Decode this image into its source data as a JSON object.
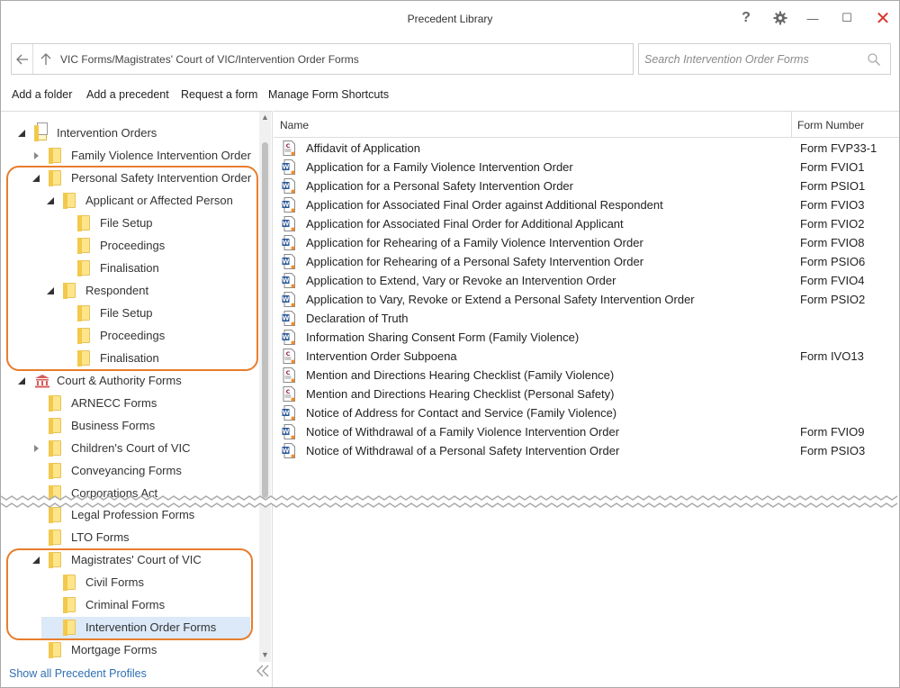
{
  "window": {
    "title": "Precedent Library"
  },
  "controls": {
    "help": "?",
    "minimize": "—",
    "maximize": "☐",
    "close": "✕"
  },
  "address": {
    "path": "VIC Forms/Magistrates' Court of VIC/Intervention Order Forms"
  },
  "search": {
    "placeholder": "Search Intervention Order Forms",
    "value": ""
  },
  "commands": [
    "Add a folder",
    "Add a precedent",
    "Request a form",
    "Manage Form Shortcuts"
  ],
  "tree": [
    {
      "label": "Intervention Orders",
      "icon": "doc-folder-icon",
      "expander": "expanded",
      "level": 0
    },
    {
      "label": "Family Violence Intervention Order",
      "icon": "folder-icon",
      "expander": "collapsed",
      "level": 1
    },
    {
      "label": "Personal Safety Intervention Order",
      "icon": "folder-icon",
      "expander": "expanded",
      "level": 1
    },
    {
      "label": "Applicant or Affected Person",
      "icon": "folder-icon",
      "expander": "expanded",
      "level": 2
    },
    {
      "label": "File Setup",
      "icon": "folder-icon",
      "expander": "none",
      "level": 3
    },
    {
      "label": "Proceedings",
      "icon": "folder-icon",
      "expander": "none",
      "level": 3
    },
    {
      "label": "Finalisation",
      "icon": "folder-icon",
      "expander": "none",
      "level": 3
    },
    {
      "label": "Respondent",
      "icon": "folder-icon",
      "expander": "expanded",
      "level": 2
    },
    {
      "label": "File Setup",
      "icon": "folder-icon",
      "expander": "none",
      "level": 3
    },
    {
      "label": "Proceedings",
      "icon": "folder-icon",
      "expander": "none",
      "level": 3
    },
    {
      "label": "Finalisation",
      "icon": "folder-icon",
      "expander": "none",
      "level": 3
    },
    {
      "label": "Court & Authority Forms",
      "icon": "court-icon",
      "expander": "expanded",
      "level": 0
    },
    {
      "label": "ARNECC Forms",
      "icon": "folder-icon",
      "expander": "none",
      "level": 1
    },
    {
      "label": "Business Forms",
      "icon": "folder-icon",
      "expander": "none",
      "level": 1
    },
    {
      "label": "Children's Court of VIC",
      "icon": "folder-icon",
      "expander": "collapsed",
      "level": 1
    },
    {
      "label": "Conveyancing Forms",
      "icon": "folder-icon",
      "expander": "none",
      "level": 1
    },
    {
      "label": "Corporations Act",
      "icon": "folder-icon",
      "expander": "none",
      "level": 1
    },
    {
      "label": "Legal Profession Forms",
      "icon": "folder-icon",
      "expander": "none",
      "level": 1
    },
    {
      "label": "LTO Forms",
      "icon": "folder-icon",
      "expander": "none",
      "level": 1
    },
    {
      "label": "Magistrates' Court of VIC",
      "icon": "folder-icon",
      "expander": "expanded",
      "level": 1
    },
    {
      "label": "Civil Forms",
      "icon": "folder-icon",
      "expander": "none",
      "level": 2
    },
    {
      "label": "Criminal Forms",
      "icon": "folder-icon",
      "expander": "none",
      "level": 2
    },
    {
      "label": "Intervention Order Forms",
      "icon": "folder-icon",
      "expander": "none",
      "level": 2,
      "selected": true
    },
    {
      "label": "Mortgage Forms",
      "icon": "folder-icon",
      "expander": "none",
      "level": 1
    }
  ],
  "footer": {
    "show_all": "Show all Precedent Profiles"
  },
  "list": {
    "columns": {
      "name": "Name",
      "form": "Form Number"
    },
    "rows": [
      {
        "type": "court-form-icon",
        "name": "Affidavit of Application",
        "form": "Form FVP33-1"
      },
      {
        "type": "word-doc-icon",
        "name": "Application for a Family Violence Intervention Order",
        "form": "Form FVIO1"
      },
      {
        "type": "word-doc-icon",
        "name": "Application for a Personal Safety Intervention Order",
        "form": "Form PSIO1"
      },
      {
        "type": "word-doc-icon",
        "name": "Application for Associated Final Order against Additional Respondent",
        "form": "Form FVIO3"
      },
      {
        "type": "word-doc-icon",
        "name": "Application for Associated Final Order for Additional Applicant",
        "form": "Form FVIO2"
      },
      {
        "type": "word-doc-icon",
        "name": "Application for Rehearing of a Family Violence Intervention Order",
        "form": "Form FVIO8"
      },
      {
        "type": "word-doc-icon",
        "name": "Application for Rehearing of a Personal Safety Intervention Order",
        "form": "Form PSIO6"
      },
      {
        "type": "word-doc-icon",
        "name": "Application to Extend, Vary or Revoke an Intervention Order",
        "form": "Form FVIO4"
      },
      {
        "type": "word-doc-icon",
        "name": "Application to Vary, Revoke or Extend a Personal Safety Intervention Order",
        "form": "Form PSIO2"
      },
      {
        "type": "word-doc-icon",
        "name": "Declaration of Truth",
        "form": ""
      },
      {
        "type": "word-doc-icon",
        "name": "Information Sharing Consent Form (Family Violence)",
        "form": ""
      },
      {
        "type": "court-form-icon",
        "name": "Intervention Order Subpoena",
        "form": "Form IVO13"
      },
      {
        "type": "court-form-icon",
        "name": "Mention and Directions Hearing Checklist (Family Violence)",
        "form": ""
      },
      {
        "type": "court-form-icon",
        "name": "Mention and Directions Hearing Checklist (Personal Safety)",
        "form": ""
      },
      {
        "type": "word-doc-icon",
        "name": "Notice of Address for Contact and Service (Family Violence)",
        "form": ""
      },
      {
        "type": "word-doc-icon",
        "name": "Notice of Withdrawal of a Family Violence Intervention Order",
        "form": "Form FVIO9"
      },
      {
        "type": "word-doc-icon",
        "name": "Notice of Withdrawal of a Personal Safety Intervention Order",
        "form": "Form PSIO3"
      }
    ]
  },
  "colors": {
    "accent": "#2f6fb3",
    "highlight": "#e87d2d",
    "selection": "#dbe9f8",
    "close": "#d9342b"
  }
}
